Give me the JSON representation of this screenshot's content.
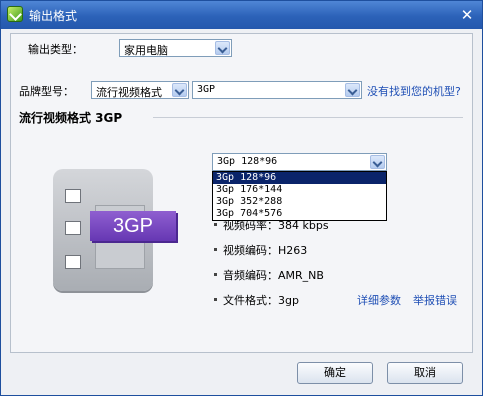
{
  "window": {
    "title": "输出格式"
  },
  "output_type": {
    "label": "输出类型：",
    "value": "家用电脑"
  },
  "brand": {
    "label": "品牌型号：",
    "category_value": "流行视频格式",
    "model_value": "3GP",
    "help_link": "没有找到您的机型?"
  },
  "section": {
    "title": "流行视频格式 3GP"
  },
  "device": {
    "badge": "3GP"
  },
  "resolution": {
    "value": "3Gp 128*96",
    "options": [
      "3Gp 128*96",
      "3Gp 176*144",
      "3Gp 352*288",
      "3Gp 704*576"
    ]
  },
  "specs": {
    "bitrate": "视频码率：384 kbps",
    "video_codec": "视频编码：H263",
    "audio_codec": "音频编码：AMR_NB",
    "file_format": "文件格式：3gp"
  },
  "links": {
    "details": "详细参数",
    "report": "举报错误"
  },
  "buttons": {
    "ok": "确定",
    "cancel": "取消"
  }
}
